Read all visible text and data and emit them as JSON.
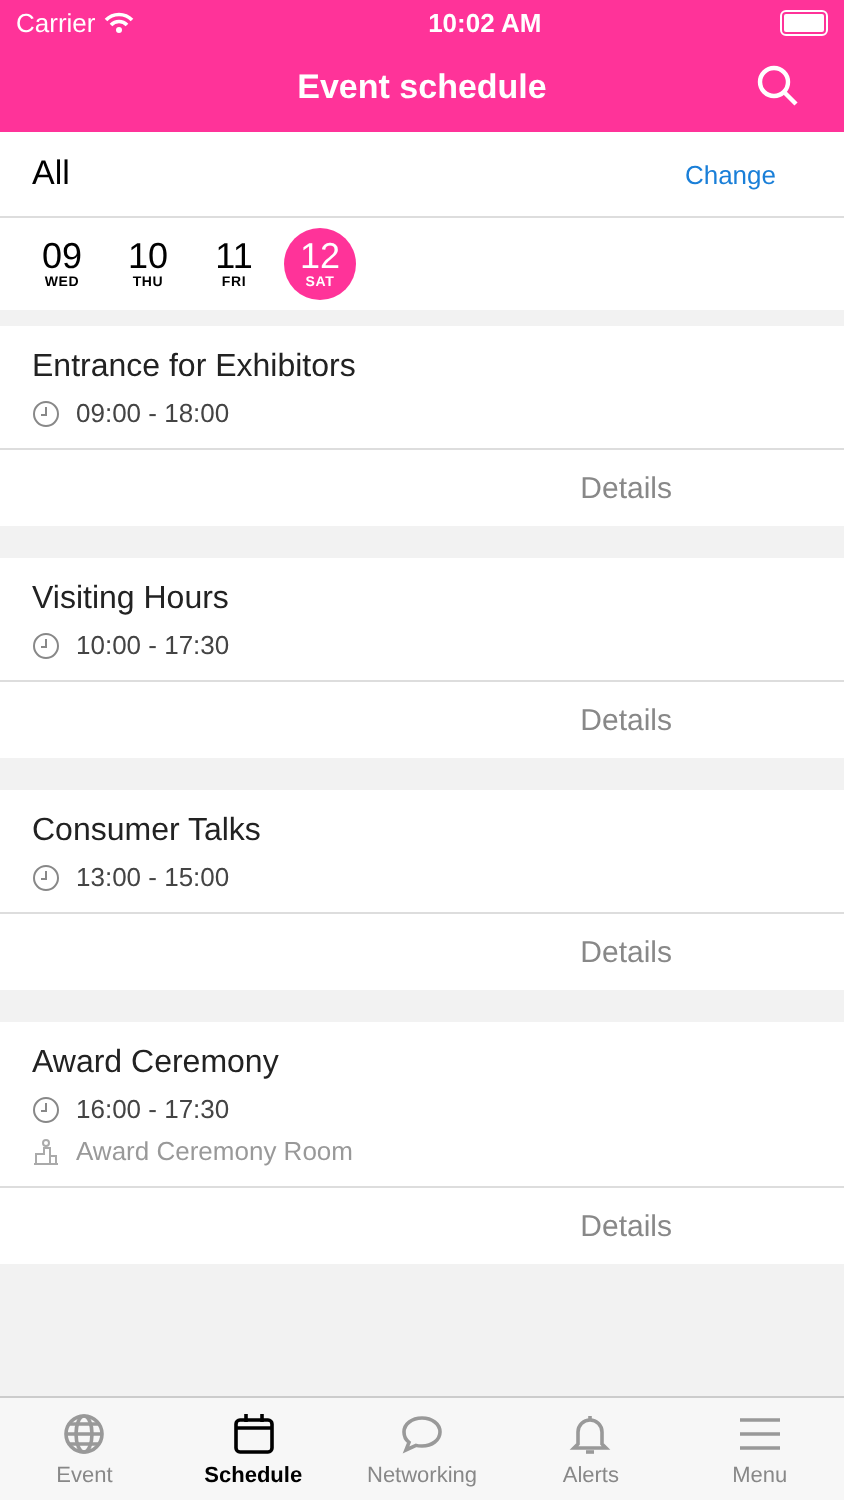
{
  "status_bar": {
    "carrier": "Carrier",
    "time": "10:02 AM"
  },
  "nav": {
    "title": "Event schedule"
  },
  "filter": {
    "label": "All",
    "action": "Change"
  },
  "dates": [
    {
      "day": "09",
      "weekday": "WED",
      "selected": false
    },
    {
      "day": "10",
      "weekday": "THU",
      "selected": false
    },
    {
      "day": "11",
      "weekday": "FRI",
      "selected": false
    },
    {
      "day": "12",
      "weekday": "SAT",
      "selected": true
    }
  ],
  "events": [
    {
      "title": "Entrance for Exhibitors",
      "time": "09:00 - 18:00",
      "details": "Details"
    },
    {
      "title": "Visiting Hours",
      "time": "10:00 - 17:30",
      "details": "Details"
    },
    {
      "title": "Consumer Talks",
      "time": "13:00 - 15:00",
      "details": "Details"
    },
    {
      "title": "Award Ceremony",
      "time": "16:00 - 17:30",
      "room": "Award Ceremony Room",
      "details": "Details"
    }
  ],
  "tab_bar": [
    {
      "label": "Event",
      "kind": "globe",
      "selected": false
    },
    {
      "label": "Schedule",
      "kind": "calendar",
      "selected": true
    },
    {
      "label": "Networking",
      "kind": "chat",
      "selected": false
    },
    {
      "label": "Alerts",
      "kind": "bell",
      "selected": false
    },
    {
      "label": "Menu",
      "kind": "menu",
      "selected": false
    }
  ]
}
